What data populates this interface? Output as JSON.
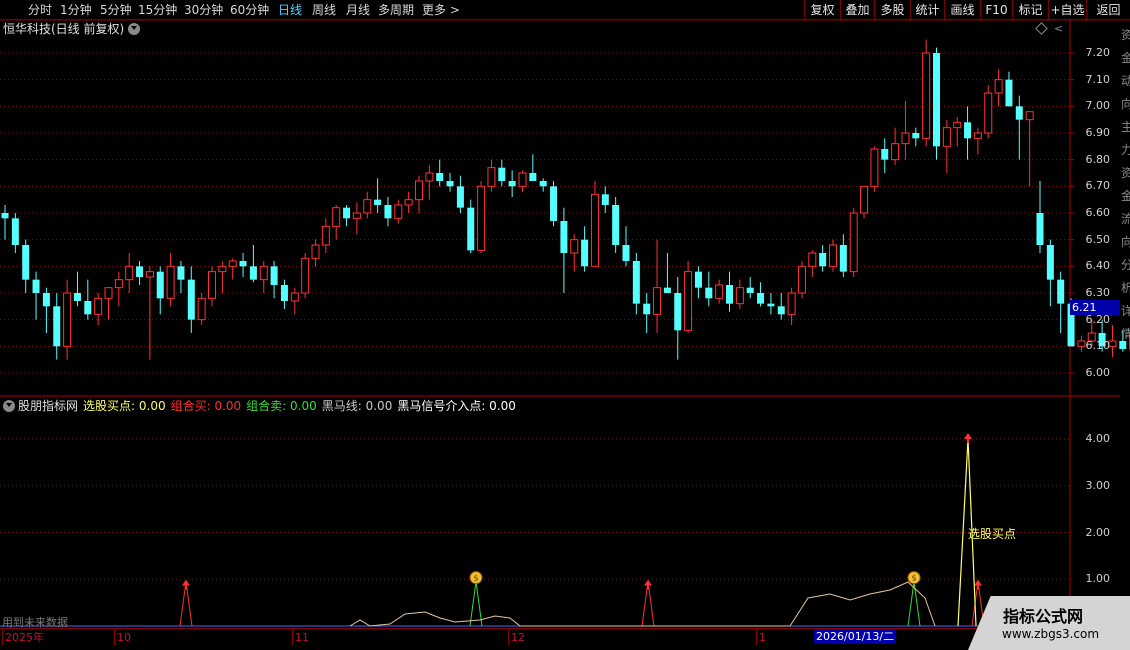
{
  "toolbar": {
    "periods": [
      "分时",
      "1分钟",
      "5分钟",
      "15分钟",
      "30分钟",
      "60分钟",
      "日线",
      "周线",
      "月线",
      "多周期",
      "更多 >"
    ],
    "active_period": "日线",
    "buttons": [
      "复权",
      "叠加",
      "多股",
      "统计",
      "画线",
      "F10",
      "标记",
      "+自选",
      "返回"
    ]
  },
  "main_chart": {
    "title": "恒华科技(日线 前复权)",
    "price_labels": [
      "7.20",
      "7.10",
      "7.00",
      "6.90",
      "6.80",
      "6.70",
      "6.60",
      "6.50",
      "6.40",
      "6.30",
      "6.20",
      "6.10",
      "6.00"
    ],
    "current_price": "6.21"
  },
  "indicator": {
    "name": "股朋指标网",
    "fields": [
      {
        "text": "选股买点: 0.00",
        "color": "#ffff66"
      },
      {
        "text": "组合买: 0.00",
        "color": "#ff3030"
      },
      {
        "text": "组合卖: 0.00",
        "color": "#33dd33"
      },
      {
        "text": "黑马线: 0.00",
        "color": "#c8c8c8"
      },
      {
        "text": "黑马信号介入点: 0.00",
        "color": "#ffffff"
      }
    ],
    "y_labels": [
      "4.00",
      "3.00",
      "2.00",
      "1.00"
    ],
    "annotation": "选股买点",
    "future_note": "用到未来数据"
  },
  "date_axis": {
    "labels": [
      "2025年",
      "10",
      "11",
      "12",
      "1"
    ],
    "selected_date": "2026/01/13/二"
  },
  "watermark": {
    "title": "指标公式网",
    "site": "www.zbgs3.com"
  },
  "side_strip_chars": [
    "资",
    "金",
    "动",
    "向",
    "主",
    "力",
    "资",
    "金",
    "流",
    "向",
    "分",
    "析",
    "详",
    "情"
  ],
  "chart_data": {
    "type": "candlestick",
    "price_axis": {
      "min": 6.0,
      "max": 7.2,
      "step": 0.1
    },
    "up_color": "#ff3232",
    "down_color": "#54ffff",
    "candles": [
      [
        6.6,
        6.63,
        6.5,
        6.58
      ],
      [
        6.58,
        6.6,
        6.45,
        6.48
      ],
      [
        6.48,
        6.5,
        6.3,
        6.35
      ],
      [
        6.35,
        6.38,
        6.2,
        6.3
      ],
      [
        6.3,
        6.32,
        6.15,
        6.25
      ],
      [
        6.25,
        6.3,
        6.05,
        6.1
      ],
      [
        6.1,
        6.35,
        6.05,
        6.3
      ],
      [
        6.3,
        6.38,
        6.25,
        6.27
      ],
      [
        6.27,
        6.35,
        6.2,
        6.22
      ],
      [
        6.22,
        6.3,
        6.18,
        6.28
      ],
      [
        6.28,
        6.32,
        6.2,
        6.32
      ],
      [
        6.32,
        6.38,
        6.25,
        6.35
      ],
      [
        6.35,
        6.45,
        6.3,
        6.4
      ],
      [
        6.4,
        6.42,
        6.33,
        6.36
      ],
      [
        6.36,
        6.4,
        6.05,
        6.38
      ],
      [
        6.38,
        6.4,
        6.22,
        6.28
      ],
      [
        6.28,
        6.45,
        6.25,
        6.4
      ],
      [
        6.4,
        6.42,
        6.3,
        6.35
      ],
      [
        6.35,
        6.4,
        6.15,
        6.2
      ],
      [
        6.2,
        6.3,
        6.18,
        6.28
      ],
      [
        6.28,
        6.4,
        6.25,
        6.38
      ],
      [
        6.38,
        6.42,
        6.3,
        6.4
      ],
      [
        6.4,
        6.43,
        6.35,
        6.42
      ],
      [
        6.42,
        6.45,
        6.36,
        6.4
      ],
      [
        6.4,
        6.48,
        6.34,
        6.35
      ],
      [
        6.35,
        6.42,
        6.3,
        6.4
      ],
      [
        6.4,
        6.42,
        6.28,
        6.33
      ],
      [
        6.33,
        6.35,
        6.24,
        6.27
      ],
      [
        6.27,
        6.32,
        6.22,
        6.3
      ],
      [
        6.3,
        6.45,
        6.28,
        6.43
      ],
      [
        6.43,
        6.5,
        6.4,
        6.48
      ],
      [
        6.48,
        6.58,
        6.45,
        6.55
      ],
      [
        6.55,
        6.63,
        6.5,
        6.62
      ],
      [
        6.62,
        6.63,
        6.55,
        6.58
      ],
      [
        6.58,
        6.64,
        6.52,
        6.6
      ],
      [
        6.6,
        6.68,
        6.58,
        6.65
      ],
      [
        6.65,
        6.73,
        6.6,
        6.63
      ],
      [
        6.63,
        6.66,
        6.55,
        6.58
      ],
      [
        6.58,
        6.65,
        6.56,
        6.63
      ],
      [
        6.63,
        6.68,
        6.6,
        6.65
      ],
      [
        6.65,
        6.74,
        6.6,
        6.72
      ],
      [
        6.72,
        6.78,
        6.65,
        6.75
      ],
      [
        6.75,
        6.8,
        6.7,
        6.72
      ],
      [
        6.72,
        6.75,
        6.68,
        6.7
      ],
      [
        6.7,
        6.74,
        6.6,
        6.62
      ],
      [
        6.62,
        6.65,
        6.45,
        6.46
      ],
      [
        6.46,
        6.72,
        6.45,
        6.7
      ],
      [
        6.7,
        6.8,
        6.68,
        6.77
      ],
      [
        6.77,
        6.8,
        6.7,
        6.72
      ],
      [
        6.72,
        6.76,
        6.66,
        6.7
      ],
      [
        6.7,
        6.76,
        6.68,
        6.75
      ],
      [
        6.75,
        6.82,
        6.72,
        6.72
      ],
      [
        6.72,
        6.73,
        6.68,
        6.7
      ],
      [
        6.7,
        6.72,
        6.55,
        6.57
      ],
      [
        6.57,
        6.62,
        6.3,
        6.45
      ],
      [
        6.45,
        6.52,
        6.38,
        6.5
      ],
      [
        6.5,
        6.55,
        6.38,
        6.4
      ],
      [
        6.4,
        6.72,
        6.4,
        6.67
      ],
      [
        6.67,
        6.7,
        6.6,
        6.63
      ],
      [
        6.63,
        6.66,
        6.45,
        6.48
      ],
      [
        6.48,
        6.55,
        6.4,
        6.42
      ],
      [
        6.42,
        6.45,
        6.22,
        6.26
      ],
      [
        6.26,
        6.3,
        6.15,
        6.22
      ],
      [
        6.22,
        6.5,
        6.15,
        6.32
      ],
      [
        6.32,
        6.45,
        6.3,
        6.3
      ],
      [
        6.3,
        6.36,
        6.05,
        6.16
      ],
      [
        6.16,
        6.42,
        6.15,
        6.38
      ],
      [
        6.38,
        6.4,
        6.28,
        6.32
      ],
      [
        6.32,
        6.38,
        6.25,
        6.28
      ],
      [
        6.28,
        6.35,
        6.26,
        6.33
      ],
      [
        6.33,
        6.38,
        6.23,
        6.26
      ],
      [
        6.26,
        6.35,
        6.24,
        6.32
      ],
      [
        6.32,
        6.36,
        6.28,
        6.3
      ],
      [
        6.3,
        6.34,
        6.25,
        6.26
      ],
      [
        6.26,
        6.3,
        6.22,
        6.25
      ],
      [
        6.25,
        6.3,
        6.2,
        6.22
      ],
      [
        6.22,
        6.32,
        6.18,
        6.3
      ],
      [
        6.3,
        6.42,
        6.28,
        6.4
      ],
      [
        6.4,
        6.46,
        6.36,
        6.45
      ],
      [
        6.45,
        6.48,
        6.38,
        6.4
      ],
      [
        6.4,
        6.5,
        6.38,
        6.48
      ],
      [
        6.48,
        6.52,
        6.36,
        6.38
      ],
      [
        6.38,
        6.62,
        6.36,
        6.6
      ],
      [
        6.6,
        6.7,
        6.58,
        6.7
      ],
      [
        6.7,
        6.85,
        6.68,
        6.84
      ],
      [
        6.84,
        6.88,
        6.75,
        6.8
      ],
      [
        6.8,
        6.92,
        6.78,
        6.86
      ],
      [
        6.86,
        7.02,
        6.8,
        6.9
      ],
      [
        6.9,
        6.92,
        6.85,
        6.88
      ],
      [
        6.88,
        7.25,
        6.85,
        7.2
      ],
      [
        7.2,
        7.22,
        6.8,
        6.85
      ],
      [
        6.85,
        6.95,
        6.75,
        6.92
      ],
      [
        6.92,
        6.96,
        6.85,
        6.94
      ],
      [
        6.94,
        7.0,
        6.8,
        6.88
      ],
      [
        6.88,
        6.92,
        6.82,
        6.9
      ],
      [
        6.9,
        7.08,
        6.88,
        7.05
      ],
      [
        7.05,
        7.14,
        7.0,
        7.1
      ],
      [
        7.1,
        7.13,
        7.0,
        7.0
      ],
      [
        7.0,
        7.04,
        6.8,
        6.95
      ],
      [
        6.95,
        6.98,
        6.7,
        6.98
      ],
      [
        6.6,
        6.72,
        6.45,
        6.48
      ],
      [
        6.48,
        6.5,
        6.25,
        6.35
      ],
      [
        6.35,
        6.38,
        6.15,
        6.26
      ],
      [
        6.26,
        6.28,
        6.1,
        6.1
      ],
      [
        6.1,
        6.14,
        6.08,
        6.12
      ],
      [
        6.12,
        6.2,
        6.1,
        6.15
      ],
      [
        6.15,
        6.2,
        6.08,
        6.1
      ],
      [
        6.1,
        6.18,
        6.06,
        6.12
      ],
      [
        6.12,
        6.16,
        6.08,
        6.09
      ],
      [
        6.09,
        6.15,
        6.05,
        6.15
      ],
      [
        6.15,
        6.2,
        6.08,
        6.13
      ],
      [
        6.13,
        6.22,
        6.1,
        6.2
      ],
      [
        6.2,
        6.28,
        6.18,
        6.27
      ]
    ]
  }
}
